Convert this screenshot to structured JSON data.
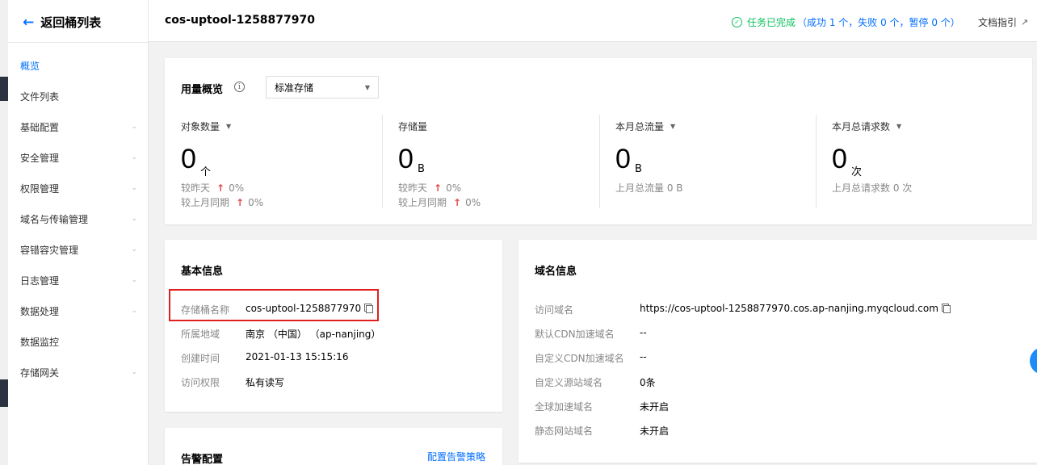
{
  "sidebar": {
    "back_label": "返回桶列表",
    "items": [
      {
        "label": "概览",
        "active": true,
        "has_children": false
      },
      {
        "label": "文件列表",
        "active": false,
        "has_children": false
      },
      {
        "label": "基础配置",
        "active": false,
        "has_children": true
      },
      {
        "label": "安全管理",
        "active": false,
        "has_children": true
      },
      {
        "label": "权限管理",
        "active": false,
        "has_children": true
      },
      {
        "label": "域名与传输管理",
        "active": false,
        "has_children": true
      },
      {
        "label": "容错容灾管理",
        "active": false,
        "has_children": true
      },
      {
        "label": "日志管理",
        "active": false,
        "has_children": true
      },
      {
        "label": "数据处理",
        "active": false,
        "has_children": true
      },
      {
        "label": "数据监控",
        "active": false,
        "has_children": false
      },
      {
        "label": "存储网关",
        "active": false,
        "has_children": true
      }
    ]
  },
  "header": {
    "bucket_title": "cos-uptool-1258877970",
    "task_status": "任务已完成",
    "task_detail": "（成功 1 个，失败 0 个，暂停 0 个）",
    "doc_link": "文档指引"
  },
  "usage": {
    "title": "用量概览",
    "storage_class": "标准存储",
    "metrics": [
      {
        "label": "对象数量",
        "has_dropdown": true,
        "value": "0",
        "unit": "个",
        "cmp1_label": "较昨天",
        "cmp1_value": "0%",
        "cmp2_label": "较上月同期",
        "cmp2_value": "0%"
      },
      {
        "label": "存储量",
        "has_dropdown": false,
        "value": "0",
        "unit": "B",
        "cmp1_label": "较昨天",
        "cmp1_value": "0%",
        "cmp2_label": "较上月同期",
        "cmp2_value": "0%"
      },
      {
        "label": "本月总流量",
        "has_dropdown": true,
        "value": "0",
        "unit": "B",
        "last": "上月总流量 0 B"
      },
      {
        "label": "本月总请求数",
        "has_dropdown": true,
        "value": "0",
        "unit": "次",
        "last": "上月总请求数 0 次"
      }
    ]
  },
  "basic_info": {
    "title": "基本信息",
    "rows": [
      {
        "key": "存储桶名称",
        "value": "cos-uptool-1258877970"
      },
      {
        "key": "所属地域",
        "value": "南京 （中国） （ap-nanjing）"
      },
      {
        "key": "创建时间",
        "value": "2021-01-13 15:15:16"
      },
      {
        "key": "访问权限",
        "value": "私有读写"
      }
    ]
  },
  "domain_info": {
    "title": "域名信息",
    "rows": [
      {
        "key": "访问域名",
        "value": "https://cos-uptool-1258877970.cos.ap-nanjing.myqcloud.com"
      },
      {
        "key": "默认CDN加速域名",
        "value": "--"
      },
      {
        "key": "自定义CDN加速域名",
        "value": "--"
      },
      {
        "key": "自定义源站域名",
        "value": "0条"
      },
      {
        "key": "全球加速域名",
        "value": "未开启"
      },
      {
        "key": "静态网站域名",
        "value": "未开启"
      }
    ]
  },
  "alarm": {
    "title": "告警配置",
    "link": "配置告警策略"
  },
  "colors": {
    "accent": "#006eff",
    "success": "#0abf5b",
    "up_arrow": "#e54545",
    "highlight_box": "#e02020"
  }
}
